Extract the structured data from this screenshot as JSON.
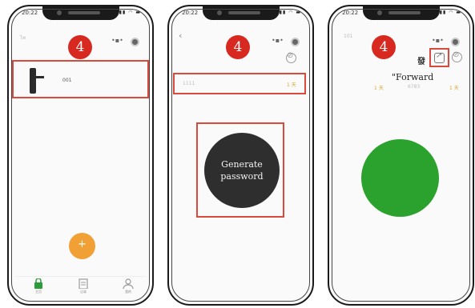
{
  "phones": [
    {
      "time": "20:22",
      "step": "4",
      "top_left": "ไพ",
      "device_label": "001",
      "tabs": [
        "主页",
        "记录",
        "我的"
      ]
    },
    {
      "time": "20:22",
      "step": "4",
      "back_glyph": "‹",
      "row_left": "1111",
      "row_right": "1 天",
      "button_line1": "Generate",
      "button_line2": "password"
    },
    {
      "time": "20:22",
      "step": "4",
      "top_left": "101",
      "side_char": "發",
      "forward_label": "\"Forward",
      "row_left_value": "1 天",
      "row_mid": "6783",
      "row_right_value": "1 天"
    }
  ],
  "colors": {
    "step_badge": "#d7291f",
    "highlight_box": "#d84a3c",
    "generate_button": "#2e2e2e",
    "green_circle": "#2ba12e",
    "add_button": "#f0a035"
  }
}
